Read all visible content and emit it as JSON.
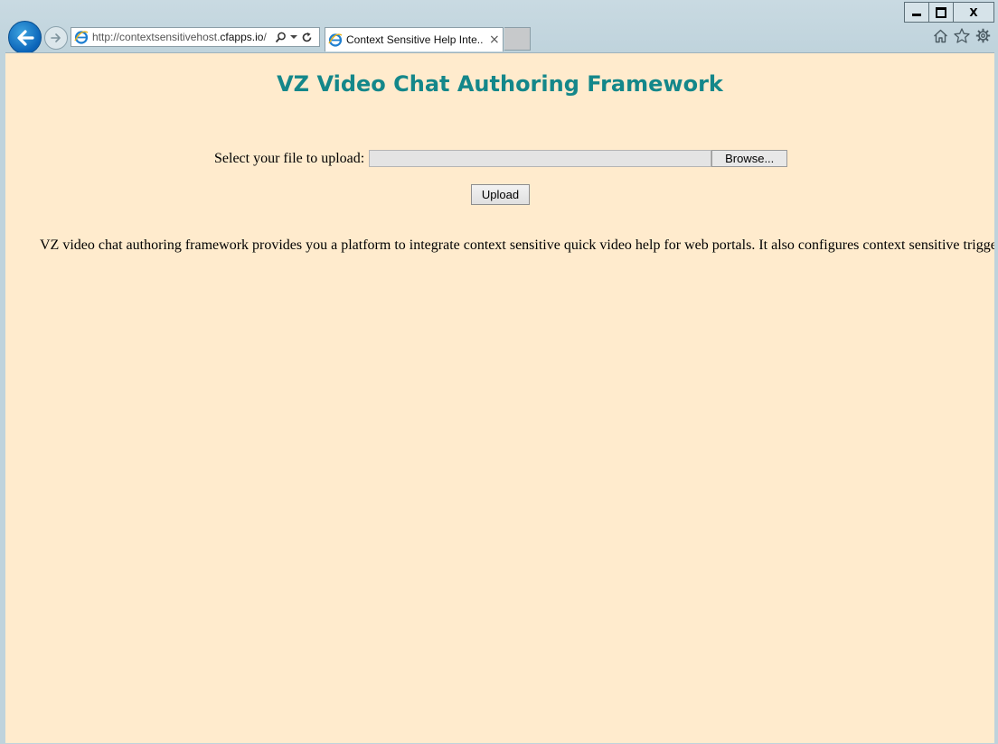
{
  "browser": {
    "url_prefix": "http://contextsensitivehost.",
    "url_domain": "cfapps.io",
    "url_suffix": "/",
    "tab_title": "Context Sensitive Help Inte...",
    "tab_close": "×"
  },
  "window_controls": {
    "close_label": "X"
  },
  "icons": [
    "back-icon",
    "forward-icon",
    "ie-icon",
    "search-icon",
    "dropdown-icon",
    "refresh-icon",
    "home-icon",
    "favorites-star-icon",
    "gear-icon"
  ],
  "page": {
    "title": "VZ Video Chat Authoring Framework",
    "upload_label": "Select your file to upload:",
    "browse_label": "Browse...",
    "upload_button": "Upload",
    "description": "VZ video chat authoring framework provides you a platform to integrate context sensitive quick video help for web portals. It also configures context sensitive triggers"
  },
  "colors": {
    "page_background": "#ffebcd",
    "title_color": "#14878a"
  }
}
